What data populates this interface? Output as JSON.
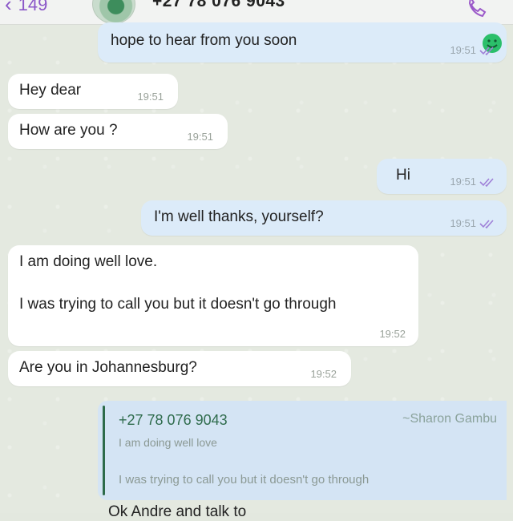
{
  "header": {
    "back_count": "149",
    "contact": "+27 78 076 9043"
  },
  "messages": [
    {
      "text": "hope to hear from you soon",
      "emoji": "smile-emoji",
      "time": "19:51",
      "dir": "out"
    },
    {
      "text": "Hey dear",
      "time": "19:51",
      "dir": "in"
    },
    {
      "text": "How are you ?",
      "time": "19:51",
      "dir": "in"
    },
    {
      "text": "Hi",
      "time": "19:51",
      "dir": "out"
    },
    {
      "text": "I'm well thanks, yourself?",
      "time": "19:51",
      "dir": "out"
    },
    {
      "text": "I am doing well love.\n\nI was trying to call you but it doesn't go through",
      "time": "19:52",
      "dir": "in"
    },
    {
      "text": "Are you in Johannesburg?",
      "time": "19:52",
      "dir": "in"
    }
  ],
  "quote": {
    "name": "+27 78 076 9043",
    "alias": "~Sharon Gambu",
    "line1": "I am doing well love",
    "line2": "I was trying to call you but it doesn't go through"
  },
  "partial_reply": "Ok Andre and talk to"
}
